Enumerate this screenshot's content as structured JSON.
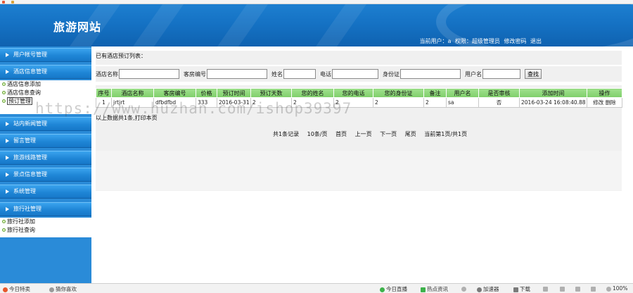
{
  "header": {
    "site_title": "旅游网站",
    "current_user_label": "当前用户：",
    "current_user": "a",
    "role_label": "权限：",
    "role": "超级管理员",
    "change_password": "修改密码",
    "logout": "退出"
  },
  "sidebar": {
    "groups": [
      {
        "label": "用户帐号管理",
        "items": []
      },
      {
        "label": "酒店信息管理",
        "items": [
          "酒店信息添加",
          "酒店信息查询",
          "预订管理"
        ]
      },
      {
        "label": "站内新闻管理",
        "items": []
      },
      {
        "label": "留言管理",
        "items": []
      },
      {
        "label": "旅游线路管理",
        "items": []
      },
      {
        "label": "景点信息管理",
        "items": []
      },
      {
        "label": "系统管理",
        "items": []
      },
      {
        "label": "旅行社管理",
        "items": [
          "旅行社添加",
          "旅行社查询"
        ]
      }
    ]
  },
  "main": {
    "list_title": "已有酒店预订列表：",
    "search": {
      "hotel_name_label": "酒店名称",
      "room_no_label": "客房编号",
      "name_label": "姓名",
      "phone_label": "电话",
      "idcard_label": "身份证",
      "username_label": "用户名",
      "button": "查找"
    },
    "table": {
      "headers": [
        "序号",
        "酒店名称",
        "客房编号",
        "价格",
        "预订时间",
        "预订天数",
        "您的姓名",
        "您的电话",
        "您的身份证",
        "备注",
        "用户名",
        "是否审核",
        "添加时间",
        "操作"
      ],
      "rows": [
        [
          "1",
          "jrtjrt",
          "dfbdfbd",
          "333",
          "2016-03-31",
          "2",
          "2",
          "2",
          "2",
          "2",
          "sa",
          "否",
          "2016-03-24 16:08:40.88",
          "修改",
          "删除"
        ]
      ]
    },
    "summary": "以上数据共1条,",
    "print_link": "打印本页",
    "pager": {
      "total": "共1条记录",
      "per_page": "10条/页",
      "first": "首页",
      "prev": "上一页",
      "next": "下一页",
      "last": "尾页",
      "current": "当前第1页/共1页"
    }
  },
  "statusbar": {
    "left1": "今日特卖",
    "left2": "猜你喜欢",
    "live": "今日直播",
    "fullscreen": "热点资讯",
    "accelerator": "加速器",
    "download": "下载",
    "zoom": "100%"
  },
  "watermark": "https://www.huzhan.com/ishop39397"
}
